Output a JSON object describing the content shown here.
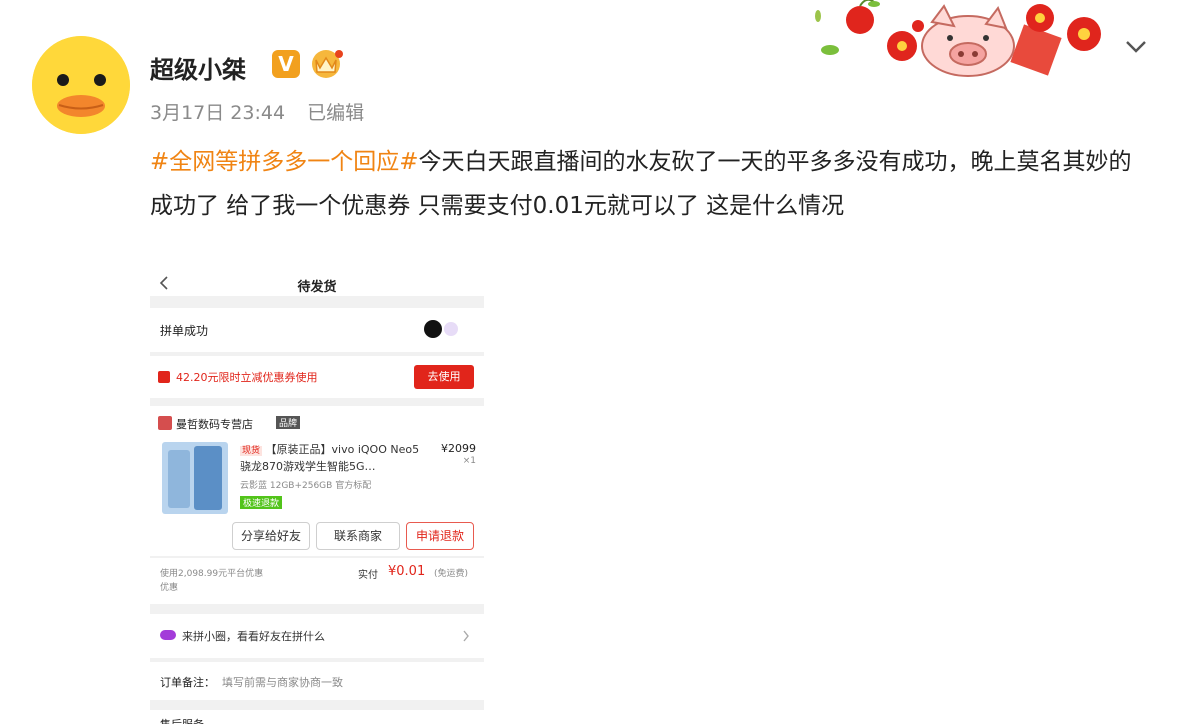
{
  "post": {
    "username": "超级小桀",
    "verified_mark": "V",
    "timestamp": "3月17日 23:44",
    "edited": "已编辑",
    "topic": "#全网等拼多多一个回应#",
    "body": "今天白天跟直播间的水友砍了一天的平多多没有成功，晚上莫名其妙的成功了 给了我一个优惠券 只需要支付0.01元就可以了 这是什么情况"
  },
  "screenshot": {
    "page_title": "待发货",
    "group_status": "拼单成功",
    "coupon_text": "42.20元限时立减优惠券使用",
    "coupon_button": "去使用",
    "store_name": "曼哲数码专营店",
    "store_badge": "品牌",
    "product_tag": "现货",
    "product_title": "【原装正品】vivo iQOO Neo5骁龙870游戏学生智能5G…",
    "product_price": "¥2099",
    "product_qty": "×1",
    "product_spec": "云影蓝 12GB+256GB 官方标配",
    "refund_tag": "极速退款",
    "btn_share": "分享给好友",
    "btn_contact": "联系商家",
    "btn_refund": "申请退款",
    "discount_note": "使用2,098.99元平台优惠",
    "discount_note2": "优惠",
    "paid_label": "实付",
    "paid_amount": "¥0.01",
    "paid_suffix": "(免运费)",
    "promo_text": "来拼小圈，看看好友在拼什么",
    "remark_label": "订单备注：",
    "remark_placeholder": "填写前需与商家协商一致",
    "bottom_label": "售后服务"
  },
  "colors": {
    "topic": "#f08413",
    "accent_red": "#e1251b",
    "vip_orange": "#f2a01e"
  },
  "icons": [
    "duck-avatar",
    "verified-v-icon",
    "crown-icon",
    "chevron-down-icon",
    "back-arrow-icon",
    "cherry-pig-decoration"
  ]
}
